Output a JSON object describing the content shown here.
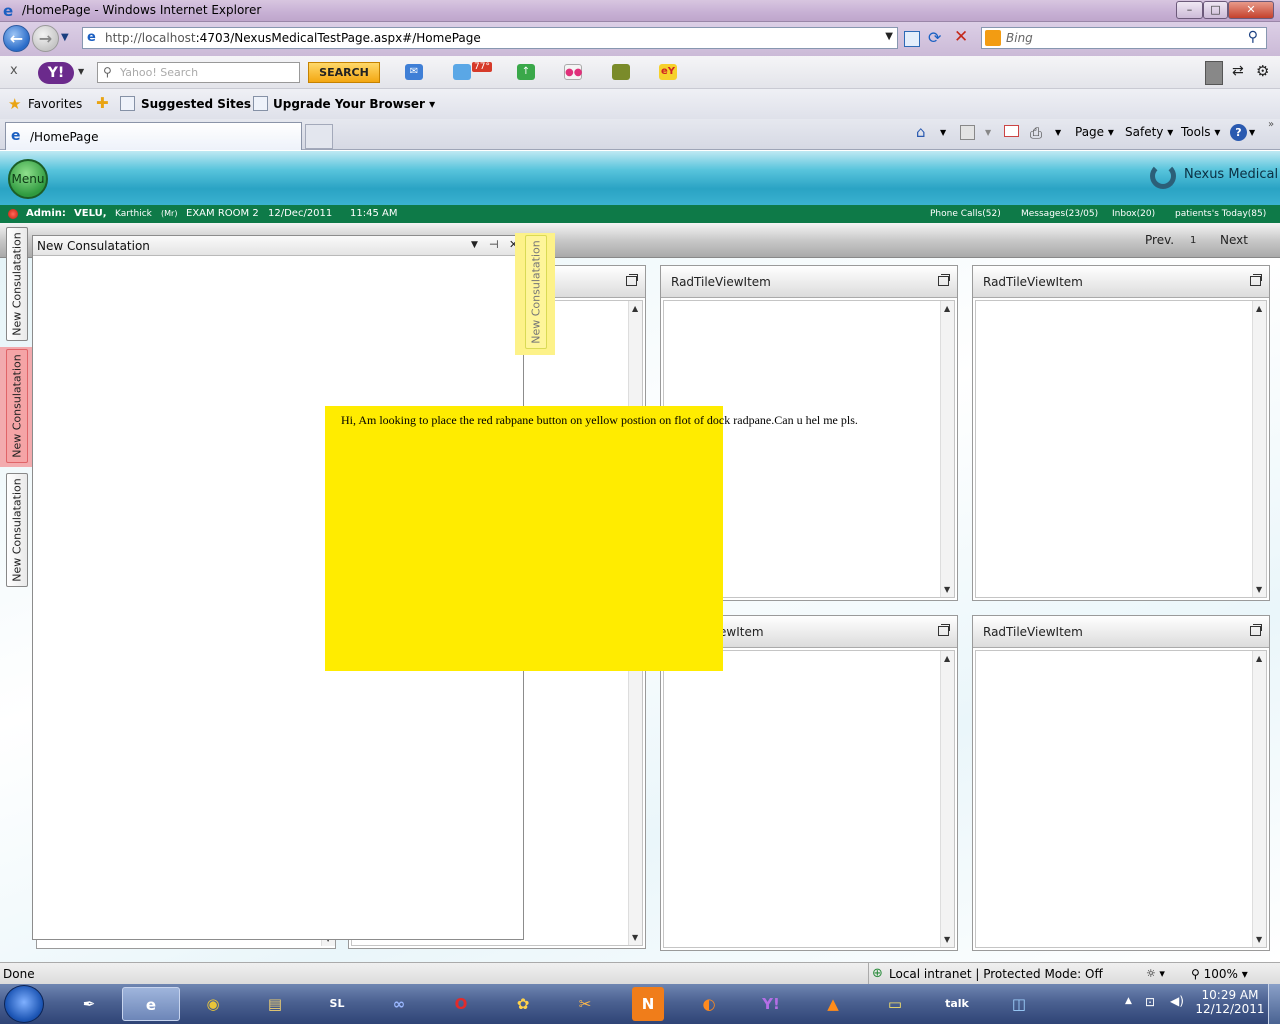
{
  "window": {
    "title": "/HomePage - Windows Internet Explorer",
    "buttons": {
      "minimize": "–",
      "maximize": "□",
      "close": "✕"
    }
  },
  "address": {
    "url_host": "http://localhost",
    "url_path": ":4703/NexusMedicalTestPage.aspx#/HomePage",
    "search_engine": "Bing"
  },
  "yahoo_toolbar": {
    "close": "x",
    "logo": "Y!",
    "search_placeholder": "Yahoo! Search",
    "search_button": "SEARCH",
    "weather_temp": "77°"
  },
  "favorites_bar": {
    "favorites": "Favorites",
    "suggested_sites": "Suggested Sites",
    "upgrade_browser": "Upgrade Your Browser"
  },
  "tabs": {
    "active_tab": "/HomePage"
  },
  "command_bar": {
    "page": "Page",
    "safety": "Safety",
    "tools": "Tools"
  },
  "app": {
    "menu_button": "Menu",
    "brand": "Nexus Medical",
    "info": {
      "role": "Admin:",
      "user": "VELU,",
      "doctor": "Karthick",
      "title": "(Mr)",
      "room": "EXAM ROOM 2",
      "date": "12/Dec/2011",
      "time": "11:45 AM",
      "phone_calls": "Phone Calls(52)",
      "messages": "Messages(23/05)",
      "inbox": "Inbox(20)",
      "patients_today": "patients's Today(85)"
    },
    "pager": {
      "prev": "Prev.",
      "page": "1",
      "next": "Next"
    },
    "dock_tabs": [
      "New Consulatation",
      "New Consulatation",
      "New Consulatation"
    ],
    "floating_tab": "New Consulatation",
    "pane": {
      "title": "New Consulatation",
      "pin": "⊣",
      "close": "✕"
    },
    "tiles": [
      {
        "title": "RadTileViewItem"
      },
      {
        "title": "RadTileViewItem"
      },
      {
        "title": "ewItem"
      },
      {
        "title": "RadTileViewItem"
      }
    ],
    "note": "Hi, Am looking to place the red rabpane button on yellow postion on flot of dock radpane.Can u hel me pls."
  },
  "statusbar": {
    "status": "Done",
    "zone": "Local intranet | Protected Mode: Off",
    "zoom": "100%"
  },
  "taskbar": {
    "clock_time": "10:29 AM",
    "clock_date": "12/12/2011"
  }
}
